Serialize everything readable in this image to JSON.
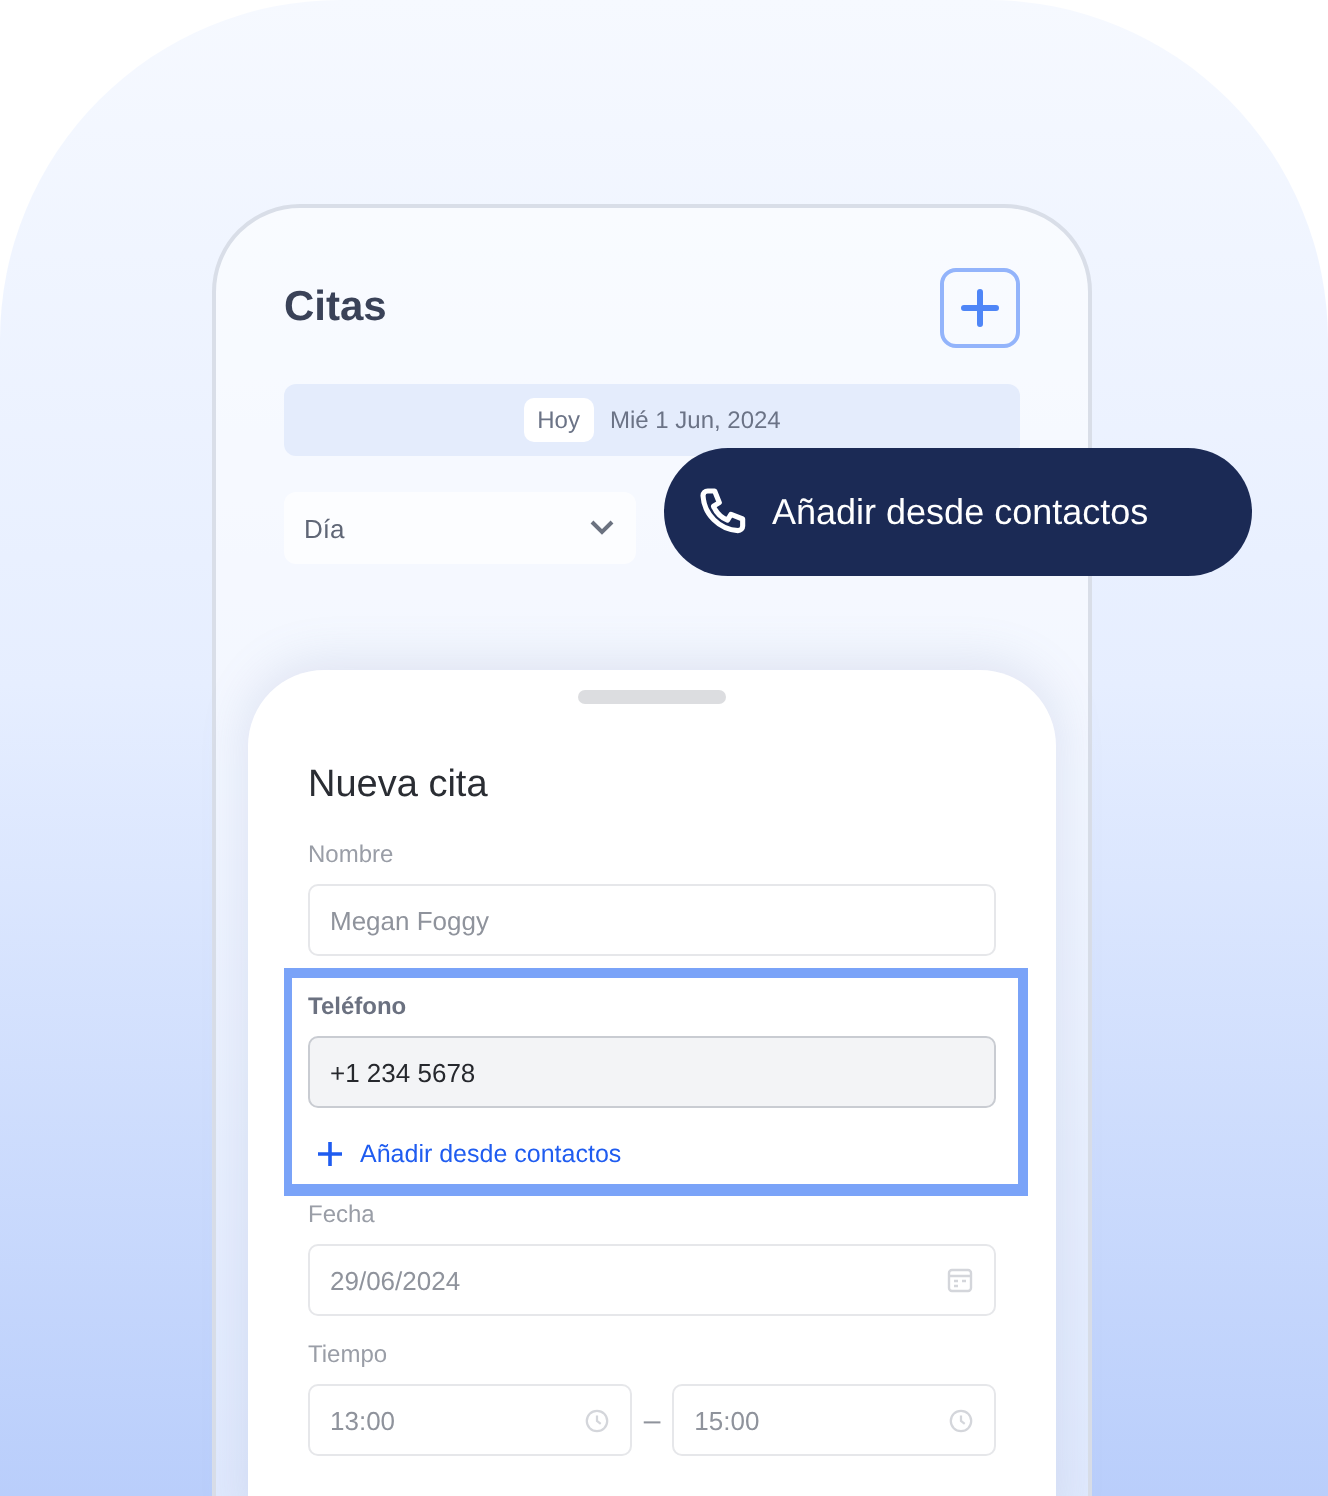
{
  "back_screen": {
    "title": "Citas",
    "date_bar": {
      "today": "Hoy",
      "date": "Mié 1 Jun, 2024"
    },
    "view_select": {
      "value": "Día"
    }
  },
  "callout": {
    "label": "Añadir desde contactos"
  },
  "sheet": {
    "title": "Nueva cita",
    "fields": [
      {
        "kind": "text",
        "label": "Nombre",
        "value": "Megan Foggy",
        "highlighted": false
      },
      {
        "kind": "text",
        "label": "Teléfono",
        "value": "+1 234 5678",
        "highlighted": true,
        "link": "Añadir desde contactos"
      },
      {
        "kind": "date",
        "label": "Fecha",
        "value": "29/06/2024",
        "highlighted": false
      },
      {
        "kind": "time_range",
        "label": "Tiempo",
        "start": "13:00",
        "separator": "–",
        "end": "15:00",
        "highlighted": false
      }
    ]
  }
}
